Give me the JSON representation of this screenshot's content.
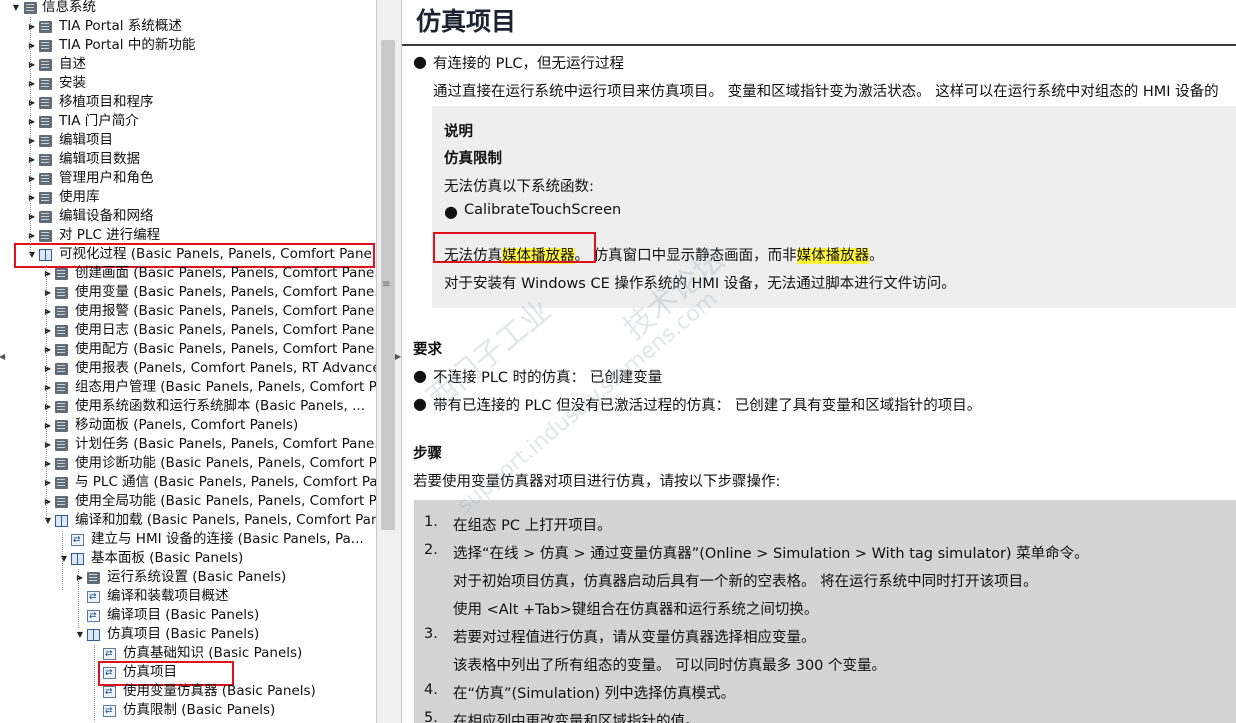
{
  "tree": {
    "items": [
      {
        "label": "信息系统",
        "depth": 0,
        "icon": "book-icon",
        "expander": "expanded"
      },
      {
        "label": "TIA Portal 系统概述",
        "depth": 1,
        "icon": "book-icon",
        "expander": "collapsed"
      },
      {
        "label": "TIA Portal 中的新功能",
        "depth": 1,
        "icon": "book-icon",
        "expander": "collapsed"
      },
      {
        "label": "自述",
        "depth": 1,
        "icon": "book-icon",
        "expander": "collapsed"
      },
      {
        "label": "安装",
        "depth": 1,
        "icon": "book-icon",
        "expander": "collapsed"
      },
      {
        "label": "移植项目和程序",
        "depth": 1,
        "icon": "book-icon",
        "expander": "collapsed"
      },
      {
        "label": "TIA 门户简介",
        "depth": 1,
        "icon": "book-icon",
        "expander": "collapsed"
      },
      {
        "label": "编辑项目",
        "depth": 1,
        "icon": "book-icon",
        "expander": "collapsed"
      },
      {
        "label": "编辑项目数据",
        "depth": 1,
        "icon": "book-icon",
        "expander": "collapsed"
      },
      {
        "label": "管理用户和角色",
        "depth": 1,
        "icon": "book-icon",
        "expander": "collapsed"
      },
      {
        "label": "使用库",
        "depth": 1,
        "icon": "book-icon",
        "expander": "collapsed"
      },
      {
        "label": "编辑设备和网络",
        "depth": 1,
        "icon": "book-icon",
        "expander": "collapsed"
      },
      {
        "label": "对 PLC 进行编程",
        "depth": 1,
        "icon": "book-icon",
        "expander": "collapsed"
      },
      {
        "label": "可视化过程 (Basic Panels, Panels, Comfort Pane...",
        "depth": 1,
        "icon": "open-book-icon",
        "expander": "expanded",
        "highlighted": true
      },
      {
        "label": "创建画面 (Basic Panels, Panels, Comfort Pane...",
        "depth": 2,
        "icon": "book-icon",
        "expander": "collapsed"
      },
      {
        "label": "使用变量 (Basic Panels, Panels, Comfort Pane...",
        "depth": 2,
        "icon": "book-icon",
        "expander": "collapsed"
      },
      {
        "label": "使用报警 (Basic Panels, Panels, Comfort Pane...",
        "depth": 2,
        "icon": "book-icon",
        "expander": "collapsed"
      },
      {
        "label": "使用日志 (Basic Panels, Panels, Comfort Pane...",
        "depth": 2,
        "icon": "book-icon",
        "expander": "collapsed"
      },
      {
        "label": "使用配方 (Basic Panels, Panels, Comfort Pane...",
        "depth": 2,
        "icon": "book-icon",
        "expander": "collapsed"
      },
      {
        "label": "使用报表 (Panels, Comfort Panels, RT Advance...",
        "depth": 2,
        "icon": "book-icon",
        "expander": "collapsed"
      },
      {
        "label": "组态用户管理 (Basic Panels, Panels, Comfort P...",
        "depth": 2,
        "icon": "book-icon",
        "expander": "collapsed"
      },
      {
        "label": "使用系统函数和运行系统脚本 (Basic Panels, ...",
        "depth": 2,
        "icon": "book-icon",
        "expander": "collapsed"
      },
      {
        "label": "移动面板 (Panels, Comfort Panels)",
        "depth": 2,
        "icon": "book-icon",
        "expander": "collapsed"
      },
      {
        "label": "计划任务 (Basic Panels, Panels, Comfort Pane...",
        "depth": 2,
        "icon": "book-icon",
        "expander": "collapsed"
      },
      {
        "label": "使用诊断功能 (Basic Panels, Panels, Comfort P...",
        "depth": 2,
        "icon": "book-icon",
        "expander": "collapsed"
      },
      {
        "label": "与 PLC 通信 (Basic Panels, Panels, Comfort Pan...",
        "depth": 2,
        "icon": "book-icon",
        "expander": "collapsed"
      },
      {
        "label": "使用全局功能 (Basic Panels, Panels, Comfort P...",
        "depth": 2,
        "icon": "book-icon",
        "expander": "collapsed"
      },
      {
        "label": "编译和加载 (Basic Panels, Panels, Comfort Pan...",
        "depth": 2,
        "icon": "open-book-icon",
        "expander": "expanded"
      },
      {
        "label": "建立与 HMI 设备的连接 (Basic Panels, Pa...",
        "depth": 3,
        "icon": "page-icon",
        "expander": "none"
      },
      {
        "label": "基本面板 (Basic Panels)",
        "depth": 3,
        "icon": "open-book-icon",
        "expander": "expanded"
      },
      {
        "label": "运行系统设置 (Basic Panels)",
        "depth": 4,
        "icon": "book-icon",
        "expander": "collapsed"
      },
      {
        "label": "编译和装载项目概述",
        "depth": 4,
        "icon": "page-icon",
        "expander": "none"
      },
      {
        "label": "编译项目 (Basic Panels)",
        "depth": 4,
        "icon": "page-icon",
        "expander": "none"
      },
      {
        "label": "仿真项目 (Basic Panels)",
        "depth": 4,
        "icon": "open-book-icon",
        "expander": "expanded"
      },
      {
        "label": "仿真基础知识 (Basic Panels)",
        "depth": 5,
        "icon": "page-icon",
        "expander": "none"
      },
      {
        "label": "仿真项目",
        "depth": 5,
        "icon": "page-icon",
        "expander": "none",
        "selected": true
      },
      {
        "label": "使用变量仿真器 (Basic Panels)",
        "depth": 5,
        "icon": "page-icon",
        "expander": "none"
      },
      {
        "label": "仿真限制 (Basic Panels)",
        "depth": 5,
        "icon": "page-icon",
        "expander": "none"
      }
    ]
  },
  "content": {
    "title": "仿真项目",
    "bullet1": "有连接的 PLC，但无运行过程",
    "para1": "通过直接在运行系统中运行项目来仿真项目。 变量和区域指针变为激活状态。 这样可以在运行系统中对组态的 HMI 设备的",
    "note": {
      "heading": "说明",
      "subheading": "仿真限制",
      "intro": "无法仿真以下系统函数:",
      "item": "CalibrateTouchScreen",
      "line1_a": "无法仿真",
      "line1_hl1": "媒体播放器",
      "line1_b": "。 仿真窗口中显示静态画面，而非",
      "line1_hl2": "媒体播放器",
      "line1_c": "。",
      "line2": "对于安装有 Windows CE 操作系统的 HMI 设备，无法通过脚本进行文件访问。"
    },
    "requirements": {
      "heading": "要求",
      "items": [
        "不连接 PLC 时的仿真： 已创建变量",
        "带有已连接的 PLC 但没有已激活过程的仿真： 已创建了具有变量和区域指针的项目。"
      ]
    },
    "steps": {
      "heading": "步骤",
      "intro": "若要使用变量仿真器对项目进行仿真，请按以下步骤操作:",
      "items": [
        {
          "num": "1.",
          "text": "在组态 PC 上打开项目。"
        },
        {
          "num": "2.",
          "text": "选择“在线 > 仿真 > 通过变量仿真器”(Online > Simulation > With tag simulator) 菜单命令。"
        },
        {
          "num": "",
          "text": "对于初始项目仿真，仿真器启动后具有一个新的空表格。 将在运行系统中同时打开该项目。"
        },
        {
          "num": "",
          "text": "使用 <Alt +Tab>键组合在仿真器和运行系统之间切换。"
        },
        {
          "num": "3.",
          "text": "若要对过程值进行仿真，请从变量仿真器选择相应变量。"
        },
        {
          "num": "",
          "text": "该表格中列出了所有组态的变量。 可以同时仿真最多 300 个变量。"
        },
        {
          "num": "4.",
          "text": "在“仿真”(Simulation) 列中选择仿真模式。"
        },
        {
          "num": "5.",
          "text": "在相应列中更改变量和区域指针的值。"
        }
      ]
    }
  },
  "watermark": {
    "text1": "西门子工业",
    "text2": "技术论坛",
    "text3": "support.industry.siemens.com"
  },
  "colors": {
    "highlight": "#fff53a",
    "red_box": "#e0101c",
    "note_bg": "#eeeeee",
    "steps_bg": "#d4d4d4"
  }
}
